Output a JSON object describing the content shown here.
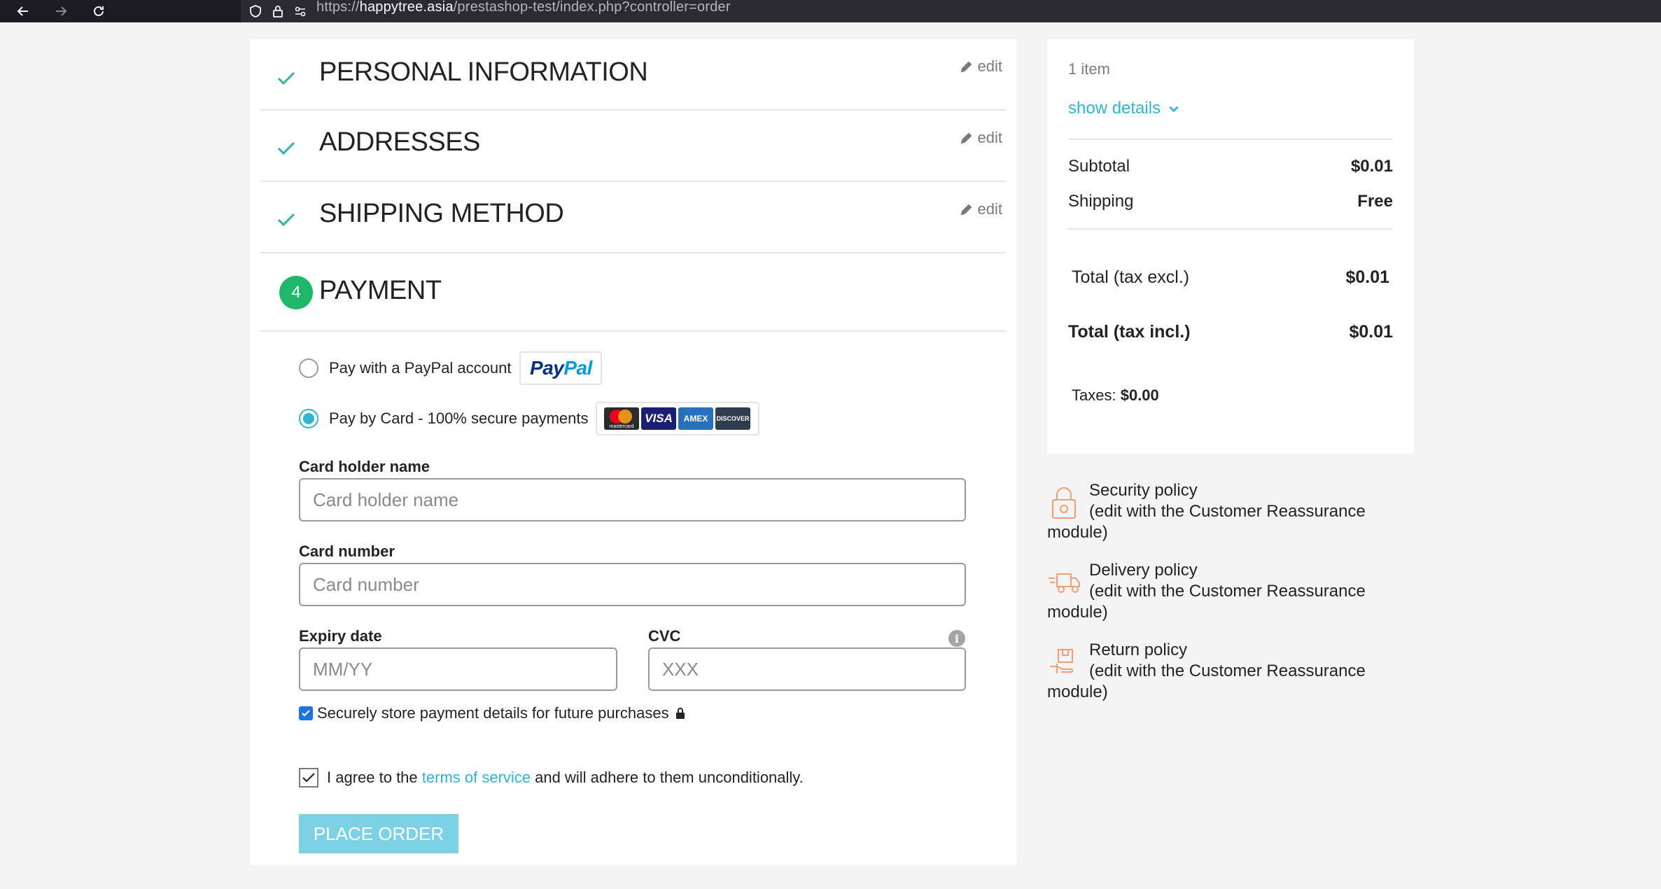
{
  "browser": {
    "url_prefix": "https://",
    "url_host": "happytree.asia",
    "url_path": "/prestashop-test/index.php?controller=order"
  },
  "steps": [
    {
      "title": "PERSONAL INFORMATION",
      "edit": "edit"
    },
    {
      "title": "ADDRESSES",
      "edit": "edit"
    },
    {
      "title": "SHIPPING METHOD",
      "edit": "edit"
    },
    {
      "number": "4",
      "title": "PAYMENT"
    }
  ],
  "payment": {
    "paypal_label": "Pay with a PayPal account",
    "paypal_logo_1": "Pay",
    "paypal_logo_2": "Pal",
    "card_label": "Pay by Card - 100% secure payments",
    "card_brands": [
      "mastercard",
      "VISA",
      "AMEX",
      "DISCOVER"
    ],
    "selected": "card"
  },
  "form": {
    "holder_label": "Card holder name",
    "holder_placeholder": "Card holder name",
    "number_label": "Card number",
    "number_placeholder": "Card number",
    "expiry_label": "Expiry date",
    "expiry_placeholder": "MM/YY",
    "cvc_label": "CVC",
    "cvc_placeholder": "XXX",
    "store_label": "Securely store payment details for future purchases",
    "store_checked": true
  },
  "terms": {
    "prefix": "I agree to the",
    "link": "terms of service",
    "suffix": "and will adhere to them unconditionally.",
    "checked": true
  },
  "place_order": "PLACE ORDER",
  "summary": {
    "items": "1 item",
    "show_details": "show details",
    "subtotal_label": "Subtotal",
    "subtotal_value": "$0.01",
    "shipping_label": "Shipping",
    "shipping_value": "Free",
    "total_excl_label": "Total (tax excl.)",
    "total_excl_value": "$0.01",
    "total_incl_label": "Total (tax incl.)",
    "total_incl_value": "$0.01",
    "taxes_label": "Taxes:",
    "taxes_value": "$0.00"
  },
  "reassurance": [
    {
      "title": "Security policy",
      "line2": "(edit with the Customer Reassurance",
      "line3": "module)",
      "icon": "lock-icon"
    },
    {
      "title": "Delivery policy",
      "line2": "(edit with the Customer Reassurance",
      "line3": "module)",
      "icon": "truck-icon"
    },
    {
      "title": "Return policy",
      "line2": "(edit with the Customer Reassurance",
      "line3": "module)",
      "icon": "return-box-icon"
    }
  ],
  "colors": {
    "accent": "#2fb5d2",
    "check": "#2fb5a0",
    "step_number_bg": "#1fb86a",
    "place_order_bg": "#7dd1e4",
    "reassurance_icon": "#f39d72"
  }
}
